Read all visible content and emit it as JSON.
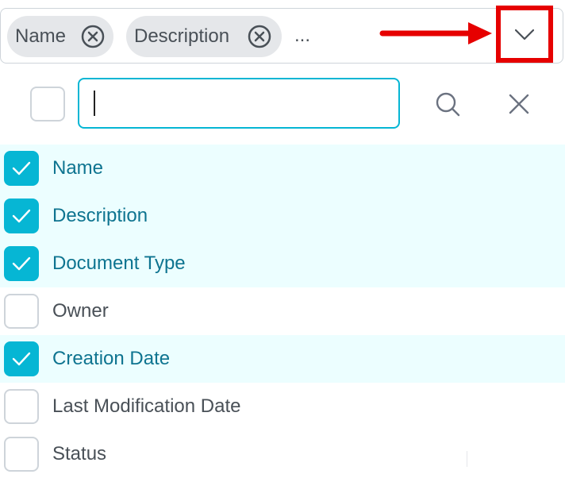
{
  "multiselect": {
    "chips": [
      {
        "label": "Name"
      },
      {
        "label": "Description"
      }
    ],
    "overflow_indicator": "...",
    "trigger_icon": "chevron-down-icon",
    "annotation_color": "#e60000"
  },
  "panel": {
    "filter": {
      "value": "",
      "placeholder": ""
    },
    "search_icon": "search-icon",
    "close_icon": "close-icon"
  },
  "options": [
    {
      "label": "Name",
      "checked": true
    },
    {
      "label": "Description",
      "checked": true
    },
    {
      "label": "Document Type",
      "checked": true
    },
    {
      "label": "Owner",
      "checked": false
    },
    {
      "label": "Creation Date",
      "checked": true
    },
    {
      "label": "Last Modification Date",
      "checked": false
    },
    {
      "label": "Status",
      "checked": false
    }
  ],
  "colors": {
    "accent": "#06b6d4",
    "selected_row_bg": "#ecfeff",
    "selected_text": "#0e7490",
    "chip_bg": "#e5e7ea"
  }
}
